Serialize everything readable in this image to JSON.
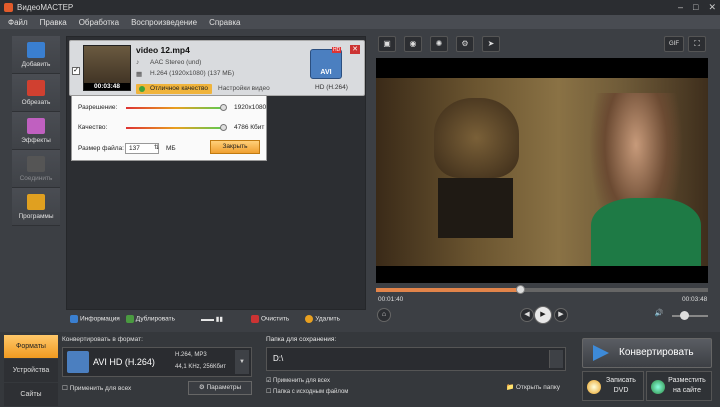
{
  "app": {
    "title": "ВидеоМАСТЕР"
  },
  "menu": [
    "Файл",
    "Правка",
    "Обработка",
    "Воспроизведение",
    "Справка"
  ],
  "sidebar": [
    {
      "label": "Добавить",
      "color": "#3a7fd0",
      "enabled": true
    },
    {
      "label": "Обрезать",
      "color": "#d04030",
      "enabled": true
    },
    {
      "label": "Эффекты",
      "color": "#c060c0",
      "enabled": true
    },
    {
      "label": "Соединить",
      "color": "#555",
      "enabled": false
    },
    {
      "label": "Программы",
      "color": "#e0a020",
      "enabled": true
    }
  ],
  "file": {
    "name": "video 12.mp4",
    "audio": "AAC Stereo (und)",
    "video": "H.264 (1920x1080) (137 МБ)",
    "duration": "00:03:48",
    "quality": "Отличное качество",
    "video_settings": "Настройки видео",
    "format_tag": "HD (H.264)",
    "format_icon": "AVI",
    "hd_badge": "HD"
  },
  "popup": {
    "resolution_label": "Разрешение:",
    "resolution_value": "1920x1080",
    "resolution_level": 0.95,
    "quality_label": "Качество:",
    "quality_value": "4786 Кбит",
    "quality_level": 0.95,
    "filesize_label": "Размер файла:",
    "filesize_value": "137",
    "filesize_unit": "МБ",
    "close_label": "Закрыть"
  },
  "toolbar": {
    "info": "Информация",
    "duplicate": "Дублировать",
    "clear": "Очистить",
    "delete": "Удалить"
  },
  "player": {
    "current": "00:01:40",
    "total": "00:03:48",
    "progress": 0.44
  },
  "tabs": [
    {
      "label": "Форматы",
      "active": true
    },
    {
      "label": "Устройства",
      "active": false
    },
    {
      "label": "Сайты",
      "active": false
    }
  ],
  "format": {
    "label": "Конвертировать в формат:",
    "name": "AVI HD (H.264)",
    "info1": "H.264, MP3",
    "info2": "44,1 KHz, 256Кбит",
    "apply_all": "Применить для всех",
    "params": "Параметры"
  },
  "save": {
    "label": "Папка для сохранения:",
    "path": "D:\\",
    "apply_all": "Применить для всех",
    "source_folder": "Папка с исходным файлом",
    "open_folder": "Открыть папку"
  },
  "actions": {
    "convert": "Конвертировать",
    "burn_line1": "Записать",
    "burn_line2": "DVD",
    "publish_line1": "Разместить",
    "publish_line2": "на сайте"
  },
  "toptools": [
    "screen-icon",
    "snapshot-icon",
    "color-icon",
    "settings-icon",
    "speed-icon"
  ],
  "gif_label": "GIF"
}
